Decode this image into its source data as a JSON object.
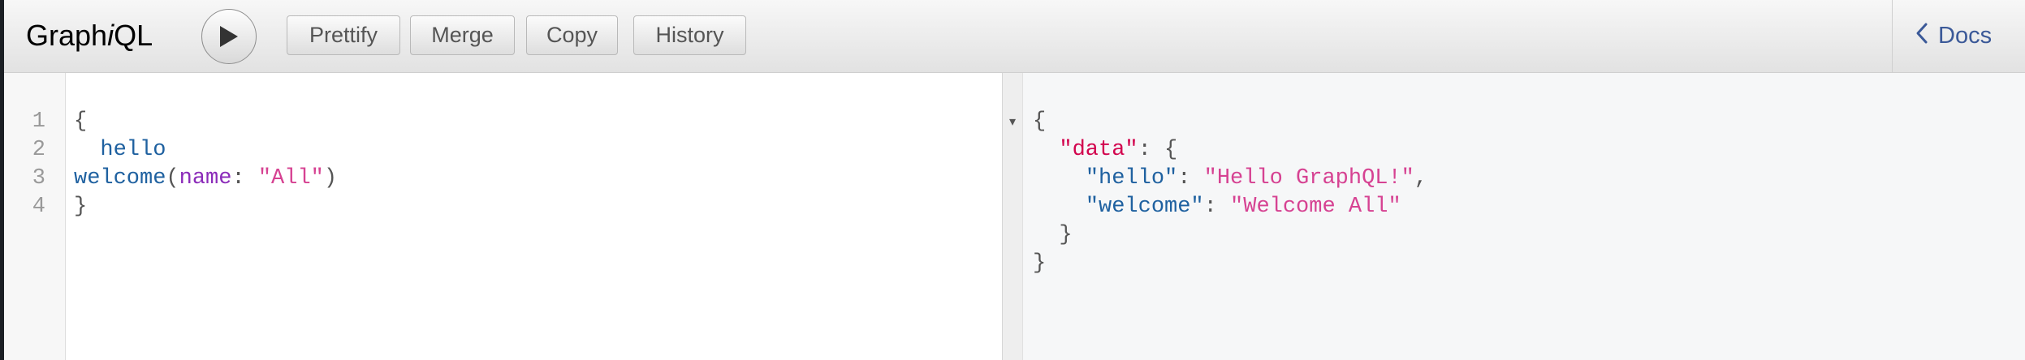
{
  "header": {
    "logo_prefix": "Graph",
    "logo_italic": "i",
    "logo_suffix": "QL",
    "buttons": {
      "prettify": "Prettify",
      "merge": "Merge",
      "copy": "Copy",
      "history": "History"
    },
    "docs": "Docs"
  },
  "editor": {
    "line_numbers": [
      "1",
      "2",
      "3",
      "4"
    ],
    "line1": {
      "brace": "{"
    },
    "line2": {
      "indent": "  ",
      "field": "hello"
    },
    "line3": {
      "field": "welcome",
      "open": "(",
      "arg": "name",
      "colon": ": ",
      "value": "\"All\"",
      "close": ")"
    },
    "line4": {
      "brace": "}"
    }
  },
  "result": {
    "fold_glyph": "▾",
    "line1": "{",
    "line2": {
      "indent": "  ",
      "key": "\"data\"",
      "rest": ": {"
    },
    "line3": {
      "indent": "    ",
      "key": "\"hello\"",
      "sep": ": ",
      "value": "\"Hello GraphQL!\"",
      "comma": ","
    },
    "line4": {
      "indent": "    ",
      "key": "\"welcome\"",
      "sep": ": ",
      "value": "\"Welcome All\""
    },
    "line5": "  }",
    "line6": "}"
  },
  "colors": {
    "field": "#1f61a0",
    "argument": "#8b2bb9",
    "string": "#d64292",
    "json_key": "#d2054e",
    "docs_link": "#3b5998"
  },
  "icons": {
    "execute": "play-icon",
    "docs": "chevron-left-icon"
  }
}
